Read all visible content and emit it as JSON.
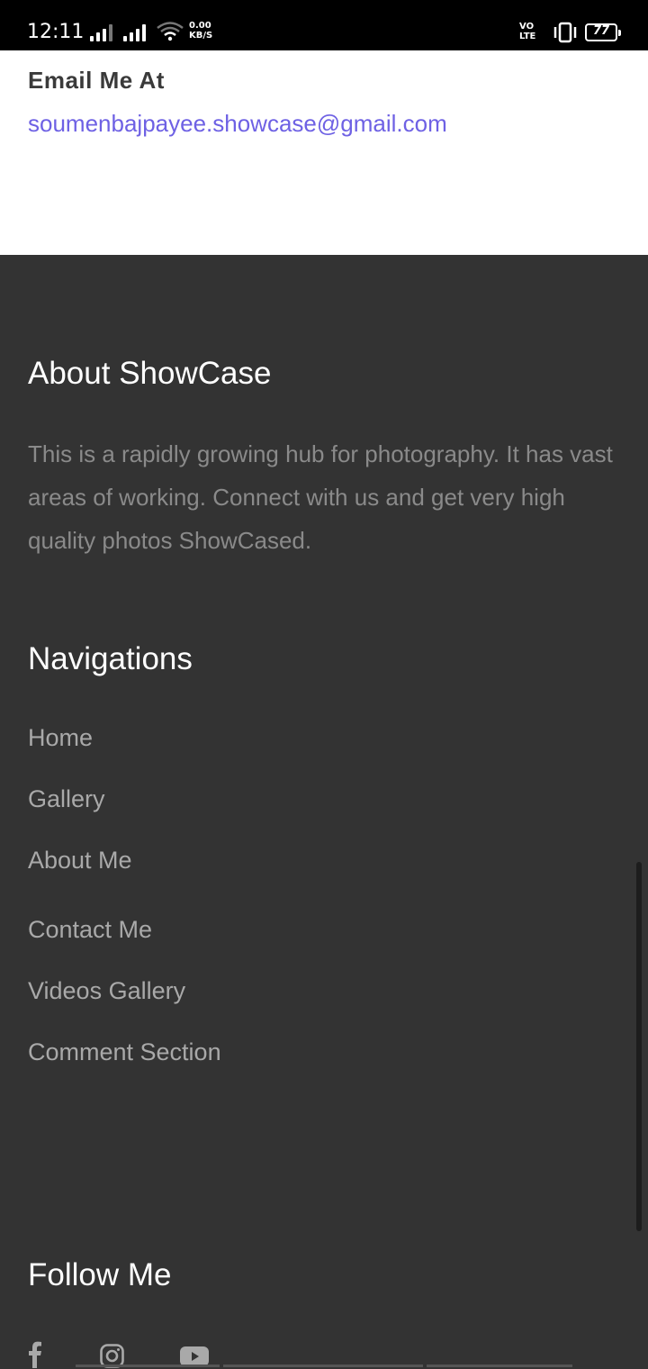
{
  "status_bar": {
    "time": "12:11",
    "speed_top": "0.00",
    "speed_bottom": "KB/S",
    "volte_top": "VO",
    "volte_bottom": "LTE",
    "battery": "77"
  },
  "email": {
    "heading": "Email Me At",
    "address": "soumenbajpayee.showcase@gmail.com",
    "link_color": "#6e61e4"
  },
  "about": {
    "title": "About ShowCase",
    "text": "This is a rapidly growing hub for photography. It has vast areas of working. Connect with us and get very high quality photos ShowCased."
  },
  "navigations": {
    "title": "Navigations",
    "items": [
      {
        "label": "Home"
      },
      {
        "label": "Gallery"
      },
      {
        "label": "About Me"
      },
      {
        "label": "Contact Me"
      },
      {
        "label": "Videos Gallery"
      },
      {
        "label": "Comment Section"
      }
    ]
  },
  "follow": {
    "title": "Follow Me",
    "icons": [
      "facebook-icon",
      "instagram-icon",
      "youtube-icon"
    ]
  },
  "colors": {
    "footer_bg": "#333333",
    "heading_white": "#ffffff",
    "body_gray": "#8a8a8a",
    "nav_gray": "#a9a9a9"
  }
}
